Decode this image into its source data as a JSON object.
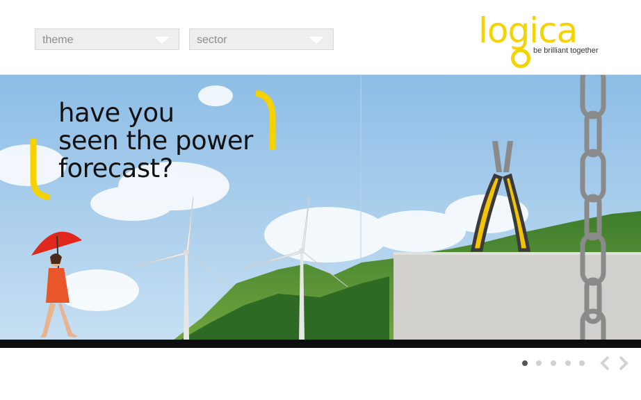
{
  "filters": {
    "theme": {
      "value": "theme",
      "icon": "chevron-down-icon"
    },
    "sector": {
      "value": "sector",
      "icon": "chevron-down-icon"
    }
  },
  "brand": {
    "name": "logica",
    "tagline": "be brilliant together",
    "color": "#f6d200"
  },
  "hero": {
    "headline": [
      "have you",
      "seen the power",
      "forecast?"
    ],
    "accent_color": "#f6d200"
  },
  "carousel": {
    "slides": 5,
    "active_slide": 1,
    "prev_icon": "chevron-left-icon",
    "next_icon": "chevron-right-icon"
  }
}
